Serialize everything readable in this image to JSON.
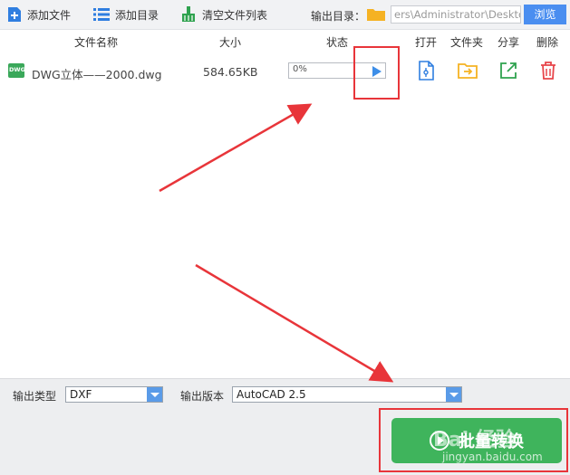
{
  "toolbar": {
    "add_file_label": "添加文件",
    "add_folder_label": "添加目录",
    "clear_list_label": "清空文件列表",
    "output_dir_label": "输出目录：",
    "output_path": "ers\\Administrator\\Desktop",
    "browse_label": "浏览"
  },
  "table": {
    "headers": {
      "name": "文件名称",
      "size": "大小",
      "status": "状态",
      "open": "打开",
      "folder": "文件夹",
      "share": "分享",
      "delete": "删除"
    },
    "rows": [
      {
        "icon_text": "DWG",
        "name": "DWG立体——2000.dwg",
        "size": "584.65KB",
        "progress": "0%"
      }
    ]
  },
  "bottom": {
    "output_type_label": "输出类型",
    "output_type_value": "DXF",
    "output_version_label": "输出版本",
    "output_version_value": "AutoCAD 2.5",
    "convert_label": "批量转换"
  },
  "watermark": {
    "brand": "Bai 经验",
    "url": "jingyan.baidu.com"
  },
  "colors": {
    "accent_blue": "#4a8ef0",
    "convert_green": "#3fb45c",
    "annotation_red": "#e8353a",
    "folder_yellow": "#f5b223",
    "delete_red": "#e8454a"
  },
  "icons": {
    "add_file": "file-plus-icon",
    "add_folder": "list-icon",
    "clear": "broom-icon",
    "folder": "folder-icon",
    "play": "play-icon",
    "open": "document-icon",
    "open_folder": "folder-arrow-icon",
    "share": "share-icon",
    "delete": "trash-icon"
  }
}
